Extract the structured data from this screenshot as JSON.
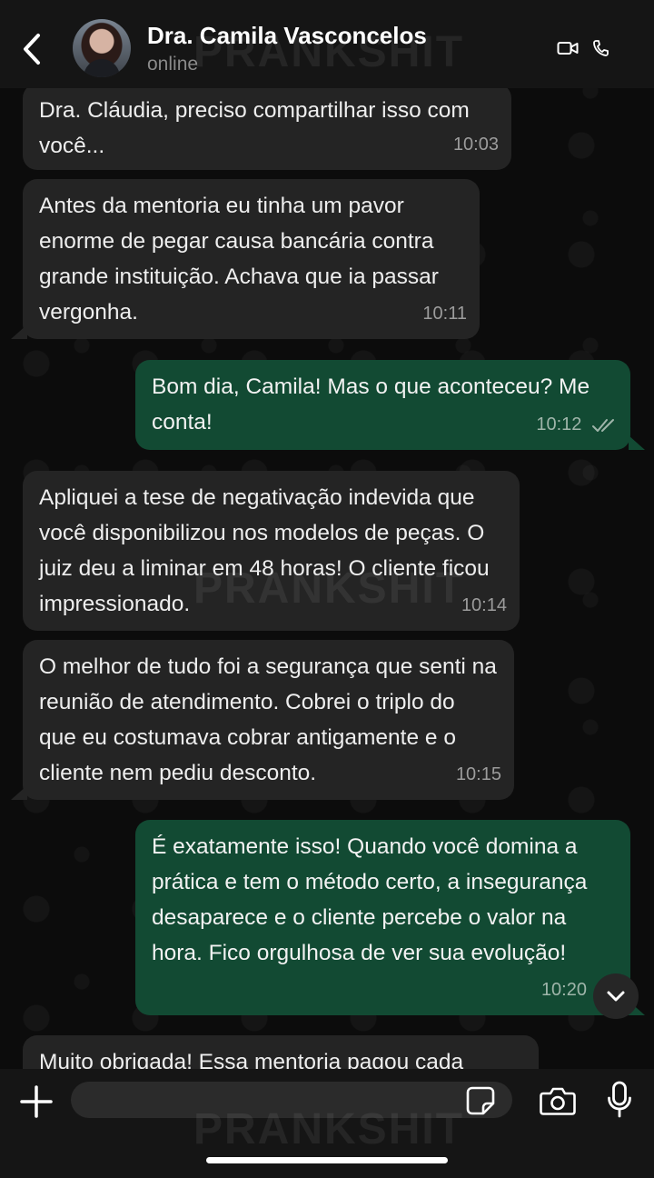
{
  "header": {
    "contact_name": "Dra. Camila Vasconcelos",
    "status": "online"
  },
  "watermark": "PRANKSHIT",
  "messages": [
    {
      "direction": "in",
      "text": "Dra. Cláudia, preciso compartilhar isso com você...",
      "time": "10:03"
    },
    {
      "direction": "in",
      "text": "Antes da mentoria eu tinha um pavor enorme de pegar causa bancária contra grande instituição. Achava que ia passar vergonha.",
      "time": "10:11"
    },
    {
      "direction": "out",
      "text": "Bom dia, Camila! Mas o que aconteceu? Me conta!",
      "time": "10:12",
      "status": "read"
    },
    {
      "direction": "in",
      "text": "Apliquei a tese de negativação indevida que você disponibilizou nos modelos de peças. O juiz deu a liminar em 48 horas! O cliente ficou impressionado.",
      "time": "10:14"
    },
    {
      "direction": "in",
      "text": "O melhor de tudo foi a segurança que senti na reunião de atendimento. Cobrei o triplo do que eu costumava cobrar antigamente e o cliente nem pediu desconto.",
      "time": "10:15"
    },
    {
      "direction": "out",
      "text": "É exatamente isso! Quando você domina a prática e tem o método certo, a insegurança desaparece e o cliente percebe o valor na hora. Fico orgulhosa de ver sua evolução!",
      "time": "10:20"
    },
    {
      "direction": "in",
      "text": "Muito obrigada! Essa mentoria pagou cada"
    }
  ],
  "composer": {
    "input_value": "",
    "placeholder": ""
  },
  "colors": {
    "incoming_bubble": "#242424",
    "outgoing_bubble": "#124a33",
    "background": "#0c0c0c",
    "bar": "#151515"
  },
  "icons": [
    "back-icon",
    "video-call-icon",
    "phone-icon",
    "plus-icon",
    "sticker-icon",
    "camera-icon",
    "mic-icon",
    "chevron-down-icon",
    "double-check-icon"
  ]
}
